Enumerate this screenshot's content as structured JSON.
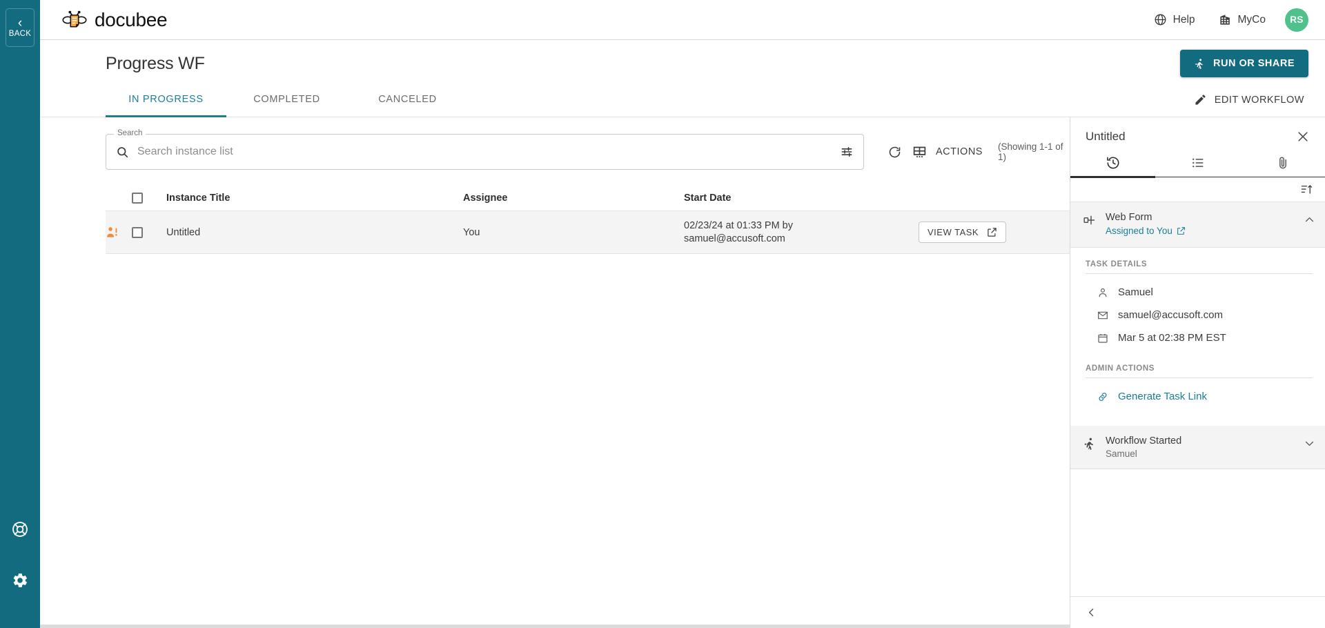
{
  "rail": {
    "back_label": "BACK",
    "back_icon": "chevron-left-icon",
    "support_icon": "life-ring-icon",
    "settings_icon": "gear-icon"
  },
  "header": {
    "logo_icon": "docubee-bee-logo",
    "brand": "docubee",
    "help_label": "Help",
    "help_icon": "globe-help-icon",
    "org_label": "MyCo",
    "org_icon": "building-icon",
    "avatar_initials": "RS",
    "avatar_color": "#4fc18b"
  },
  "page": {
    "title": "Progress WF",
    "run_or_share_label": "RUN OR SHARE",
    "run_or_share_icon": "running-person-icon",
    "edit_workflow_label": "EDIT WORKFLOW",
    "edit_workflow_icon": "pencil-icon",
    "accent_color": "#136b7f"
  },
  "tabs": [
    {
      "label": "IN PROGRESS",
      "active": true
    },
    {
      "label": "COMPLETED",
      "active": false
    },
    {
      "label": "CANCELED",
      "active": false
    }
  ],
  "search": {
    "legend": "Search",
    "placeholder": "Search instance list",
    "value": "",
    "search_icon": "magnifier-icon",
    "filter_icon": "tune-sliders-icon"
  },
  "toolbar": {
    "refresh_icon": "refresh-icon",
    "columns_icon": "table-columns-icon",
    "actions_label": "ACTIONS",
    "showing_text": "(Showing 1-1 of 1)"
  },
  "table": {
    "select_all_checked": false,
    "columns": [
      "Instance Title",
      "Assignee",
      "Start Date"
    ],
    "rows": [
      {
        "status_icon": "person-alert-icon",
        "checked": false,
        "title": "Untitled",
        "assignee": "You",
        "start_date_line1": "02/23/24 at 01:33 PM by",
        "start_date_line2": "samuel@accusoft.com",
        "action_label": "VIEW TASK",
        "action_icon": "external-link-icon"
      }
    ]
  },
  "right_panel": {
    "title": "Untitled",
    "close_icon": "close-icon",
    "tabs": [
      {
        "icon": "history-clock-icon",
        "active": true
      },
      {
        "icon": "list-icon",
        "active": false
      },
      {
        "icon": "paperclip-icon",
        "active": false
      }
    ],
    "sort_icon": "sort-ascending-icon",
    "steps": [
      {
        "icon": "web-form-node-icon",
        "title": "Web Form",
        "link_label": "Assigned to You",
        "link_icon": "external-link-icon",
        "chevron": "chevron-up-icon",
        "expanded": true
      }
    ],
    "task_details": {
      "heading": "TASK DETAILS",
      "rows": [
        {
          "icon": "person-icon",
          "text": "Samuel"
        },
        {
          "icon": "envelope-icon",
          "text": "samuel@accusoft.com"
        },
        {
          "icon": "calendar-icon",
          "text": "Mar 5 at 02:38 PM EST"
        }
      ]
    },
    "admin_actions": {
      "heading": "ADMIN ACTIONS",
      "rows": [
        {
          "icon": "link-chain-icon",
          "text": "Generate Task Link",
          "is_link": true
        }
      ]
    },
    "history_entry": {
      "icon": "running-person-icon",
      "title": "Workflow Started",
      "subtitle": "Samuel",
      "chevron": "chevron-down-icon"
    },
    "collapse_icon": "chevron-left-icon"
  }
}
